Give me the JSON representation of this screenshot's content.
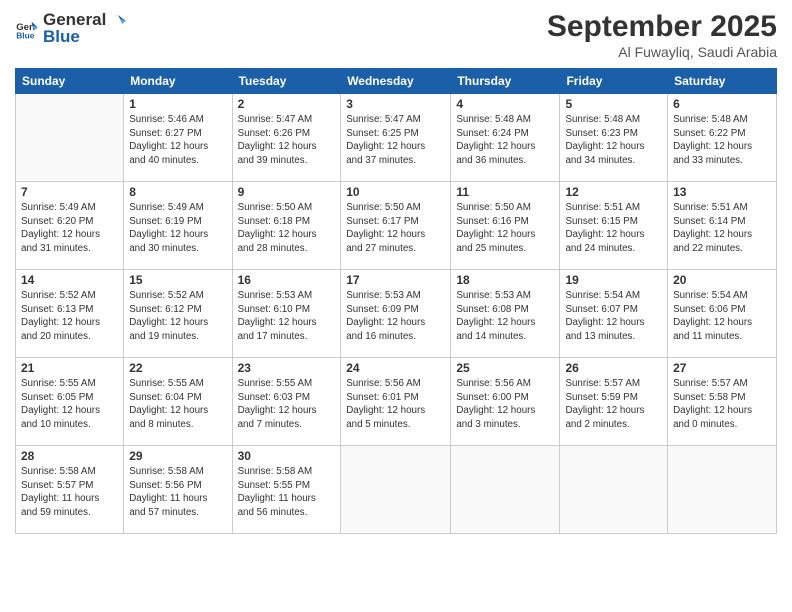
{
  "logo": {
    "general": "General",
    "blue": "Blue"
  },
  "header": {
    "month": "September 2025",
    "location": "Al Fuwayliq, Saudi Arabia"
  },
  "weekdays": [
    "Sunday",
    "Monday",
    "Tuesday",
    "Wednesday",
    "Thursday",
    "Friday",
    "Saturday"
  ],
  "weeks": [
    [
      {
        "day": "",
        "info": ""
      },
      {
        "day": "1",
        "info": "Sunrise: 5:46 AM\nSunset: 6:27 PM\nDaylight: 12 hours\nand 40 minutes."
      },
      {
        "day": "2",
        "info": "Sunrise: 5:47 AM\nSunset: 6:26 PM\nDaylight: 12 hours\nand 39 minutes."
      },
      {
        "day": "3",
        "info": "Sunrise: 5:47 AM\nSunset: 6:25 PM\nDaylight: 12 hours\nand 37 minutes."
      },
      {
        "day": "4",
        "info": "Sunrise: 5:48 AM\nSunset: 6:24 PM\nDaylight: 12 hours\nand 36 minutes."
      },
      {
        "day": "5",
        "info": "Sunrise: 5:48 AM\nSunset: 6:23 PM\nDaylight: 12 hours\nand 34 minutes."
      },
      {
        "day": "6",
        "info": "Sunrise: 5:48 AM\nSunset: 6:22 PM\nDaylight: 12 hours\nand 33 minutes."
      }
    ],
    [
      {
        "day": "7",
        "info": "Sunrise: 5:49 AM\nSunset: 6:20 PM\nDaylight: 12 hours\nand 31 minutes."
      },
      {
        "day": "8",
        "info": "Sunrise: 5:49 AM\nSunset: 6:19 PM\nDaylight: 12 hours\nand 30 minutes."
      },
      {
        "day": "9",
        "info": "Sunrise: 5:50 AM\nSunset: 6:18 PM\nDaylight: 12 hours\nand 28 minutes."
      },
      {
        "day": "10",
        "info": "Sunrise: 5:50 AM\nSunset: 6:17 PM\nDaylight: 12 hours\nand 27 minutes."
      },
      {
        "day": "11",
        "info": "Sunrise: 5:50 AM\nSunset: 6:16 PM\nDaylight: 12 hours\nand 25 minutes."
      },
      {
        "day": "12",
        "info": "Sunrise: 5:51 AM\nSunset: 6:15 PM\nDaylight: 12 hours\nand 24 minutes."
      },
      {
        "day": "13",
        "info": "Sunrise: 5:51 AM\nSunset: 6:14 PM\nDaylight: 12 hours\nand 22 minutes."
      }
    ],
    [
      {
        "day": "14",
        "info": "Sunrise: 5:52 AM\nSunset: 6:13 PM\nDaylight: 12 hours\nand 20 minutes."
      },
      {
        "day": "15",
        "info": "Sunrise: 5:52 AM\nSunset: 6:12 PM\nDaylight: 12 hours\nand 19 minutes."
      },
      {
        "day": "16",
        "info": "Sunrise: 5:53 AM\nSunset: 6:10 PM\nDaylight: 12 hours\nand 17 minutes."
      },
      {
        "day": "17",
        "info": "Sunrise: 5:53 AM\nSunset: 6:09 PM\nDaylight: 12 hours\nand 16 minutes."
      },
      {
        "day": "18",
        "info": "Sunrise: 5:53 AM\nSunset: 6:08 PM\nDaylight: 12 hours\nand 14 minutes."
      },
      {
        "day": "19",
        "info": "Sunrise: 5:54 AM\nSunset: 6:07 PM\nDaylight: 12 hours\nand 13 minutes."
      },
      {
        "day": "20",
        "info": "Sunrise: 5:54 AM\nSunset: 6:06 PM\nDaylight: 12 hours\nand 11 minutes."
      }
    ],
    [
      {
        "day": "21",
        "info": "Sunrise: 5:55 AM\nSunset: 6:05 PM\nDaylight: 12 hours\nand 10 minutes."
      },
      {
        "day": "22",
        "info": "Sunrise: 5:55 AM\nSunset: 6:04 PM\nDaylight: 12 hours\nand 8 minutes."
      },
      {
        "day": "23",
        "info": "Sunrise: 5:55 AM\nSunset: 6:03 PM\nDaylight: 12 hours\nand 7 minutes."
      },
      {
        "day": "24",
        "info": "Sunrise: 5:56 AM\nSunset: 6:01 PM\nDaylight: 12 hours\nand 5 minutes."
      },
      {
        "day": "25",
        "info": "Sunrise: 5:56 AM\nSunset: 6:00 PM\nDaylight: 12 hours\nand 3 minutes."
      },
      {
        "day": "26",
        "info": "Sunrise: 5:57 AM\nSunset: 5:59 PM\nDaylight: 12 hours\nand 2 minutes."
      },
      {
        "day": "27",
        "info": "Sunrise: 5:57 AM\nSunset: 5:58 PM\nDaylight: 12 hours\nand 0 minutes."
      }
    ],
    [
      {
        "day": "28",
        "info": "Sunrise: 5:58 AM\nSunset: 5:57 PM\nDaylight: 11 hours\nand 59 minutes."
      },
      {
        "day": "29",
        "info": "Sunrise: 5:58 AM\nSunset: 5:56 PM\nDaylight: 11 hours\nand 57 minutes."
      },
      {
        "day": "30",
        "info": "Sunrise: 5:58 AM\nSunset: 5:55 PM\nDaylight: 11 hours\nand 56 minutes."
      },
      {
        "day": "",
        "info": ""
      },
      {
        "day": "",
        "info": ""
      },
      {
        "day": "",
        "info": ""
      },
      {
        "day": "",
        "info": ""
      }
    ]
  ]
}
